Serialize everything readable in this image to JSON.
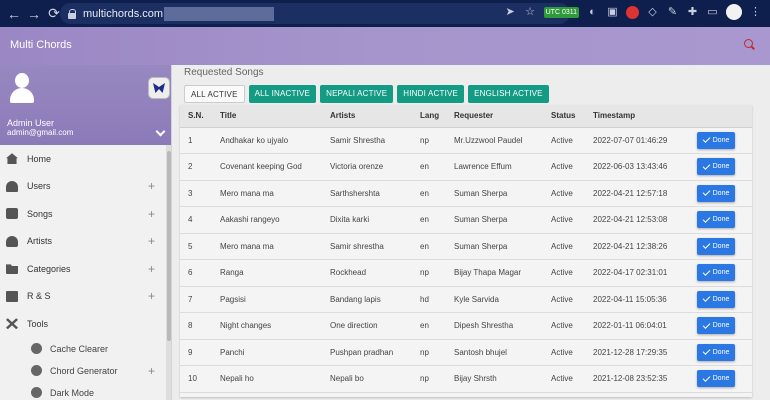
{
  "browser": {
    "url": "multichords.com",
    "back": "←",
    "forward": "→",
    "reload": "⟳",
    "badge": "UTC 0311"
  },
  "app": {
    "title": "Multi Chords"
  },
  "sidebar": {
    "admin_name": "Admin User",
    "admin_email": "admin@gmail.com",
    "items": [
      {
        "label": "Home",
        "icon": "home-icon",
        "expandable": false
      },
      {
        "label": "Users",
        "icon": "users-icon",
        "expandable": true
      },
      {
        "label": "Songs",
        "icon": "songs-icon",
        "expandable": true
      },
      {
        "label": "Artists",
        "icon": "artists-icon",
        "expandable": true
      },
      {
        "label": "Categories",
        "icon": "categories-icon",
        "expandable": true
      },
      {
        "label": "R & S",
        "icon": "rs-icon",
        "expandable": true
      },
      {
        "label": "Tools",
        "icon": "tools-icon",
        "expandable": false
      }
    ],
    "sub_items": [
      {
        "label": "Cache Clearer",
        "icon": "cache-icon"
      },
      {
        "label": "Chord Generator",
        "icon": "chord-icon",
        "expandable": true
      },
      {
        "label": "Dark Mode",
        "icon": "dark-mode-icon"
      }
    ]
  },
  "main": {
    "section_title": "Requested Songs",
    "tabs": [
      "ALL ACTIVE",
      "ALL INACTIVE",
      "NEPALI ACTIVE",
      "HINDI ACTIVE",
      "ENGLISH ACTIVE"
    ],
    "columns": [
      "S.N.",
      "Title",
      "Artists",
      "Lang",
      "Requester",
      "Status",
      "Timestamp",
      ""
    ],
    "done_label": "Done",
    "rows": [
      {
        "sn": "1",
        "title": "Andhakar ko ujyalo",
        "artists": "Samir Shrestha",
        "lang": "np",
        "requester": "Mr.Uzzwool Paudel",
        "status": "Active",
        "timestamp": "2022-07-07 01:46:29"
      },
      {
        "sn": "2",
        "title": "Covenant keeping God",
        "artists": "Victoria orenze",
        "lang": "en",
        "requester": "Lawrence Effum",
        "status": "Active",
        "timestamp": "2022-06-03 13:43:46"
      },
      {
        "sn": "3",
        "title": "Mero mana ma",
        "artists": "Sarthshershta",
        "lang": "en",
        "requester": "Suman Sherpa",
        "status": "Active",
        "timestamp": "2022-04-21 12:57:18"
      },
      {
        "sn": "4",
        "title": "Aakashi rangeyo",
        "artists": "Dixita karki",
        "lang": "en",
        "requester": "Suman Sherpa",
        "status": "Active",
        "timestamp": "2022-04-21 12:53:08"
      },
      {
        "sn": "5",
        "title": "Mero mana ma",
        "artists": "Samir shrestha",
        "lang": "en",
        "requester": "Suman Sherpa",
        "status": "Active",
        "timestamp": "2022-04-21 12:38:26"
      },
      {
        "sn": "6",
        "title": "Ranga",
        "artists": "Rockhead",
        "lang": "np",
        "requester": "Bijay Thapa Magar",
        "status": "Active",
        "timestamp": "2022-04-17 02:31:01"
      },
      {
        "sn": "7",
        "title": "Pagsisi",
        "artists": "Bandang lapis",
        "lang": "hd",
        "requester": "Kyle Sarvida",
        "status": "Active",
        "timestamp": "2022-04-11 15:05:36"
      },
      {
        "sn": "8",
        "title": "Night changes",
        "artists": "One direction",
        "lang": "en",
        "requester": "Dipesh Shrestha",
        "status": "Active",
        "timestamp": "2022-01-11 06:04:01"
      },
      {
        "sn": "9",
        "title": "Panchi",
        "artists": "Pushpan pradhan",
        "lang": "np",
        "requester": "Santosh bhujel",
        "status": "Active",
        "timestamp": "2021-12-28 17:29:35"
      },
      {
        "sn": "10",
        "title": "Nepali ho",
        "artists": "Nepali bo",
        "lang": "np",
        "requester": "Bijay Shrsth",
        "status": "Active",
        "timestamp": "2021-12-08 23:52:35"
      }
    ]
  }
}
